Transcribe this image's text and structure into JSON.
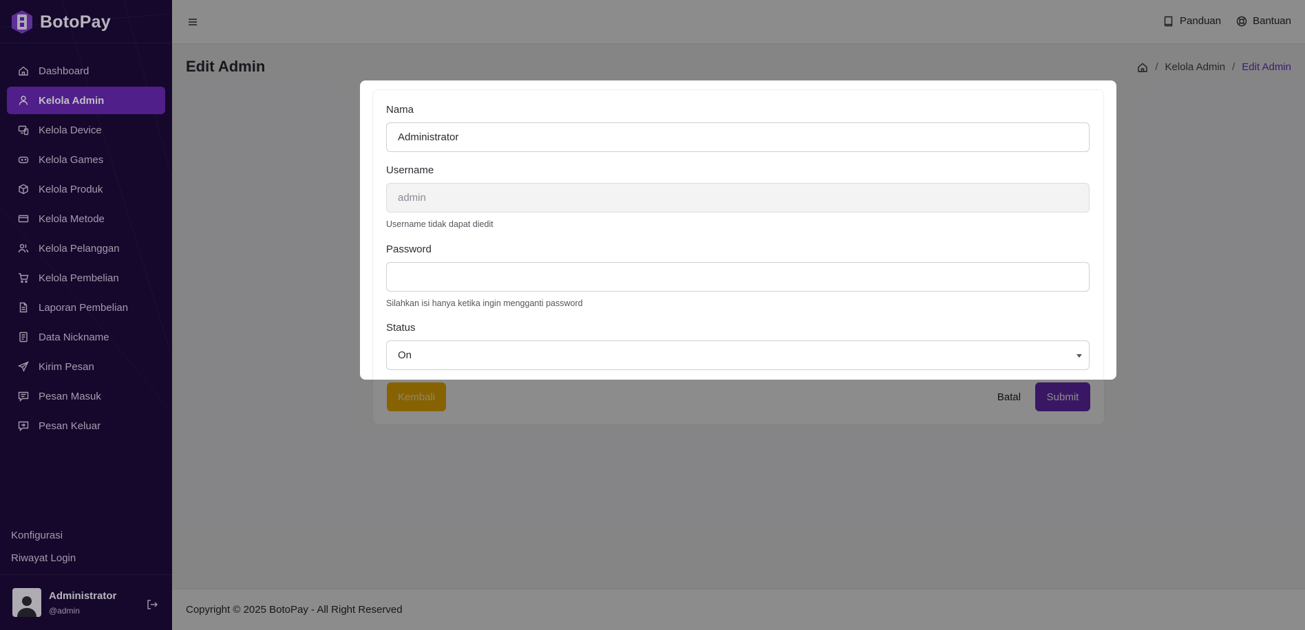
{
  "app": {
    "brand": "BotoPay"
  },
  "sidebar": {
    "items": [
      {
        "label": "Dashboard",
        "icon": "home-icon"
      },
      {
        "label": "Kelola Admin",
        "icon": "user-icon",
        "active": true
      },
      {
        "label": "Kelola Device",
        "icon": "devices-icon"
      },
      {
        "label": "Kelola Games",
        "icon": "gamepad-icon"
      },
      {
        "label": "Kelola Produk",
        "icon": "box-icon"
      },
      {
        "label": "Kelola Metode",
        "icon": "credit-card-icon"
      },
      {
        "label": "Kelola Pelanggan",
        "icon": "users-icon"
      },
      {
        "label": "Kelola Pembelian",
        "icon": "cart-icon"
      },
      {
        "label": "Laporan Pembelian",
        "icon": "document-icon"
      },
      {
        "label": "Data Nickname",
        "icon": "file-icon"
      },
      {
        "label": "Kirim Pesan",
        "icon": "send-icon"
      },
      {
        "label": "Pesan Masuk",
        "icon": "message-icon"
      },
      {
        "label": "Pesan Keluar",
        "icon": "message-out-icon"
      }
    ],
    "links": [
      "Konfigurasi",
      "Riwayat Login"
    ],
    "user": {
      "name": "Administrator",
      "handle": "@admin"
    }
  },
  "topbar": {
    "panduan": "Panduan",
    "bantuan": "Bantuan"
  },
  "page": {
    "title": "Edit Admin",
    "breadcrumb": [
      "Kelola Admin",
      "Edit Admin"
    ]
  },
  "form": {
    "nama_label": "Nama",
    "nama_value": "Administrator",
    "username_label": "Username",
    "username_value": "admin",
    "username_help": "Username tidak dapat diedit",
    "password_label": "Password",
    "password_value": "",
    "password_help": "Silahkan isi hanya ketika ingin mengganti password",
    "status_label": "Status",
    "status_value": "On",
    "kembali": "Kembali",
    "batal": "Batal",
    "submit": "Submit"
  },
  "footer": {
    "text": "Copyright © 2025 BotoPay - All Right Reserved"
  },
  "colors": {
    "sidebar": "#1e0a3c",
    "accent": "#6b2ab8",
    "warning": "#f5b400"
  }
}
